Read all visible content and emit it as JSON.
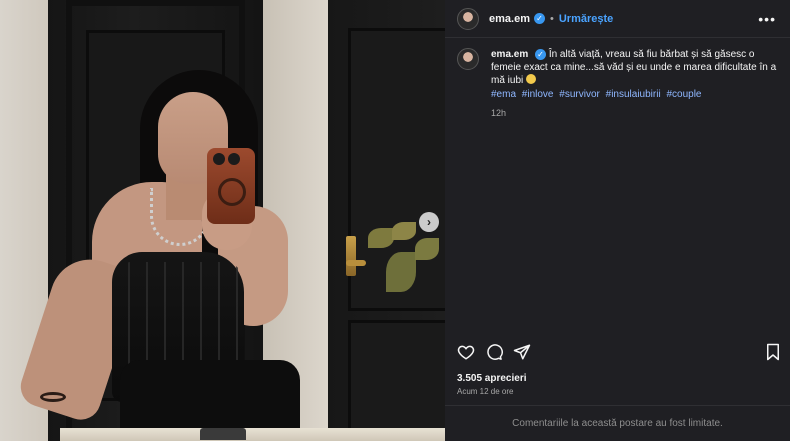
{
  "post": {
    "username": "ema.em",
    "follow_label": "Urmărește",
    "caption_text": "În altă viață, vreau să fiu bărbat și să găsesc o femeie exact ca mine...să văd și eu unde e marea dificultate în a mă iubi",
    "hashtags": [
      "#ema",
      "#inlove",
      "#survivor",
      "#insulaiubirii",
      "#couple"
    ],
    "caption_time": "12h",
    "likes": "3.505 aprecieri",
    "posted_ago": "Acum 12 de ore",
    "comments_limited": "Comentariile la această postare au fost limitate."
  },
  "icons": {
    "more": "more-horizontal-icon",
    "verified": "verified-badge-icon",
    "next": "chevron-right-icon",
    "like": "heart-icon",
    "comment": "comment-icon",
    "share": "send-icon",
    "save": "bookmark-icon"
  },
  "colors": {
    "panel_bg": "#1f1f23",
    "follow_blue": "#4aa3ff",
    "hashtag_blue": "#8fb7ff",
    "verified_blue": "#3897f0"
  }
}
